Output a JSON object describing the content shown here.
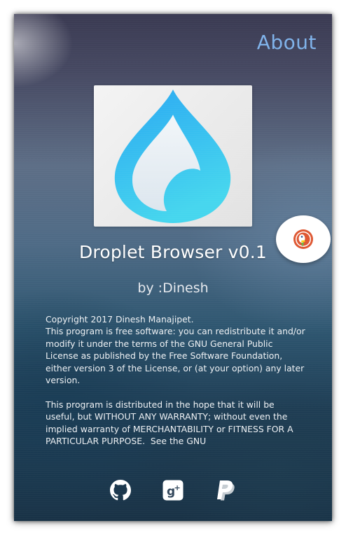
{
  "header": {
    "title": "About"
  },
  "app": {
    "logo_icon": "droplet-logo",
    "name": "Droplet Browser v0.1",
    "author": "by :Dinesh"
  },
  "fab": {
    "icon": "duckduckgo-icon"
  },
  "license": {
    "text": "Copyright 2017 Dinesh Manajipet.\nThis program is free software: you can redistribute it and/or modify it under the terms of the GNU General Public License as published by the Free Software Foundation, either version 3 of the License, or (at your option) any later version.\n\nThis program is distributed in the hope that it will be useful, but WITHOUT ANY WARRANTY; without even the implied warranty of MERCHANTABILITY or FITNESS FOR A PARTICULAR PURPOSE.  See the GNU"
  },
  "social": [
    {
      "icon": "github-icon"
    },
    {
      "icon": "google-plus-icon"
    },
    {
      "icon": "paypal-icon"
    }
  ],
  "colors": {
    "accent": "#7fb2ea",
    "droplet_light": "#4fd8f0",
    "droplet_dark": "#1f8fe8"
  }
}
